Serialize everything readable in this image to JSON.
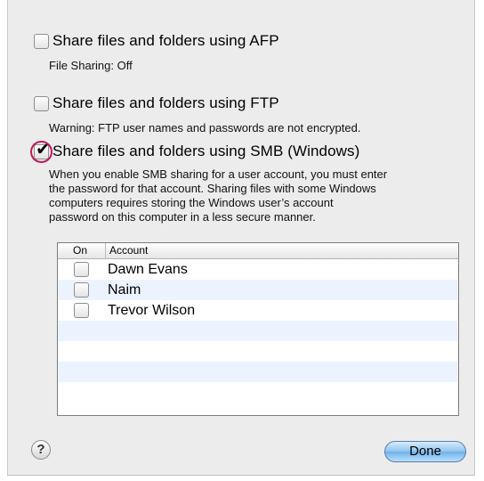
{
  "options": [
    {
      "label": "Share files and folders using AFP",
      "checked": false,
      "note": "File Sharing: Off"
    },
    {
      "label": "Share files and folders using FTP",
      "checked": false,
      "note": "Warning: FTP user names and passwords are not encrypted."
    },
    {
      "label": "Share files and folders using SMB (Windows)",
      "checked": true
    }
  ],
  "smb_description": [
    "When you enable SMB sharing for a user account, you must enter",
    "the password for that account. Sharing files with some Windows",
    "computers requires storing the Windows user’s account",
    "password on this computer in a less secure manner."
  ],
  "accounts_table": {
    "headers": {
      "on": "On",
      "account": "Account"
    },
    "rows": [
      {
        "name": "Dawn Evans",
        "on": false
      },
      {
        "name": "Naim",
        "on": false
      },
      {
        "name": "Trevor Wilson",
        "on": false
      }
    ]
  },
  "help_button": {
    "label": "?"
  },
  "done_button": {
    "label": "Done"
  },
  "colors": {
    "highlight_ring": "#c2185b",
    "done_button": "#8fc3ee",
    "row_alt": "#edf3fe"
  }
}
